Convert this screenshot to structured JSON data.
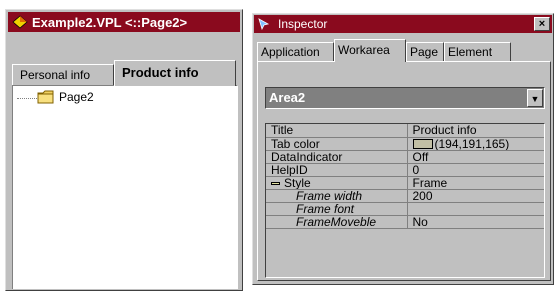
{
  "left_window": {
    "title": "Example2.VPL <::Page2>",
    "icon": "app-diamond-icon",
    "tabs": [
      {
        "label": "Personal info",
        "active": false
      },
      {
        "label": "Product info",
        "active": true
      }
    ],
    "tree": {
      "item_label": "Page2",
      "icon": "folder-icon"
    }
  },
  "inspector": {
    "title": "Inspector",
    "close_label": "×",
    "tabs": [
      {
        "label": "Application",
        "active": false
      },
      {
        "label": "Workarea",
        "active": true
      },
      {
        "label": "Page",
        "active": false
      },
      {
        "label": "Element",
        "active": false
      }
    ],
    "combo": {
      "value": "Area2",
      "arrow": "▼"
    },
    "properties": [
      {
        "name": "Title",
        "value": "Product info"
      },
      {
        "name": "Tab color",
        "value": "(194,191,165)",
        "swatch": "#c2bfa5"
      },
      {
        "name": "DataIndicator",
        "value": "Off"
      },
      {
        "name": "HelpID",
        "value": "0"
      },
      {
        "name": "Style",
        "value": "Frame",
        "expanded": true
      },
      {
        "name": "Frame width",
        "value": "200"
      },
      {
        "name": "Frame font",
        "value": ""
      },
      {
        "name": "FrameMoveble",
        "value": "No"
      }
    ]
  },
  "colors": {
    "title_bar": "#8a0a1e",
    "face": "#c0c0c0"
  }
}
